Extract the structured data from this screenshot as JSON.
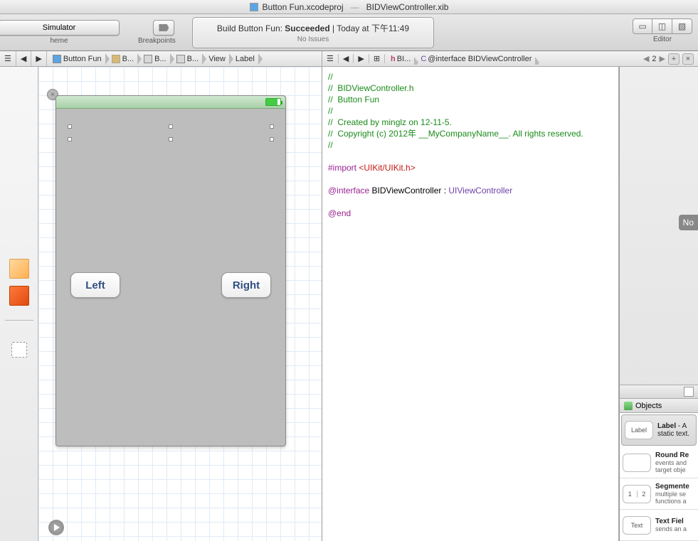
{
  "title": {
    "project": "Button Fun.xcodeproj",
    "separator": "—",
    "file": "BIDViewController.xib"
  },
  "toolbar": {
    "scheme": "Simulator",
    "scheme_label": "heme",
    "breakpoints_label": "Breakpoints",
    "editor_label": "Editor",
    "activity_prefix": "Build Button Fun: ",
    "activity_status": "Succeeded",
    "activity_sep": "  |  ",
    "activity_time": "Today at 下午11:49",
    "activity_issues": "No Issues"
  },
  "jumpbar_left": {
    "menu_icon": "☰",
    "back": "◀",
    "fwd": "▶",
    "items": [
      "Button Fun",
      "B...",
      "B...",
      "B...",
      "View",
      "Label"
    ]
  },
  "jumpbar_right": {
    "file": "BI...",
    "symbol": "@interface BIDViewController",
    "counter_back": "◀",
    "counter_num": "2",
    "counter_fwd": "▶",
    "plus": "+",
    "x": "×"
  },
  "ib": {
    "left_button": "Left",
    "right_button": "Right"
  },
  "code": {
    "l1": "//",
    "l2": "//  BIDViewController.h",
    "l3": "//  Button Fun",
    "l4": "//",
    "l5": "//  Created by minglz on 12-11-5.",
    "l6": "//  Copyright (c) 2012年 __MyCompanyName__. All rights reserved.",
    "l7": "//",
    "import_kw": "#import ",
    "import_val": "<UIKit/UIKit.h>",
    "iface_kw": "@interface ",
    "iface_class": "BIDViewController",
    "iface_colon": " : ",
    "iface_super": "UIViewController",
    "end_kw": "@end"
  },
  "util": {
    "no_label": "No",
    "objects_header": "Objects",
    "items": [
      {
        "thumb": "Label",
        "title": "Label",
        "desc": "- A static text."
      },
      {
        "thumb": "",
        "title": "Round Re",
        "desc": "events and target obje"
      },
      {
        "thumb": "1|2",
        "title": "Segmente",
        "desc": "multiple se functions a"
      },
      {
        "thumb": "Text",
        "title": "Text Fiel",
        "desc": "sends an a"
      }
    ]
  }
}
